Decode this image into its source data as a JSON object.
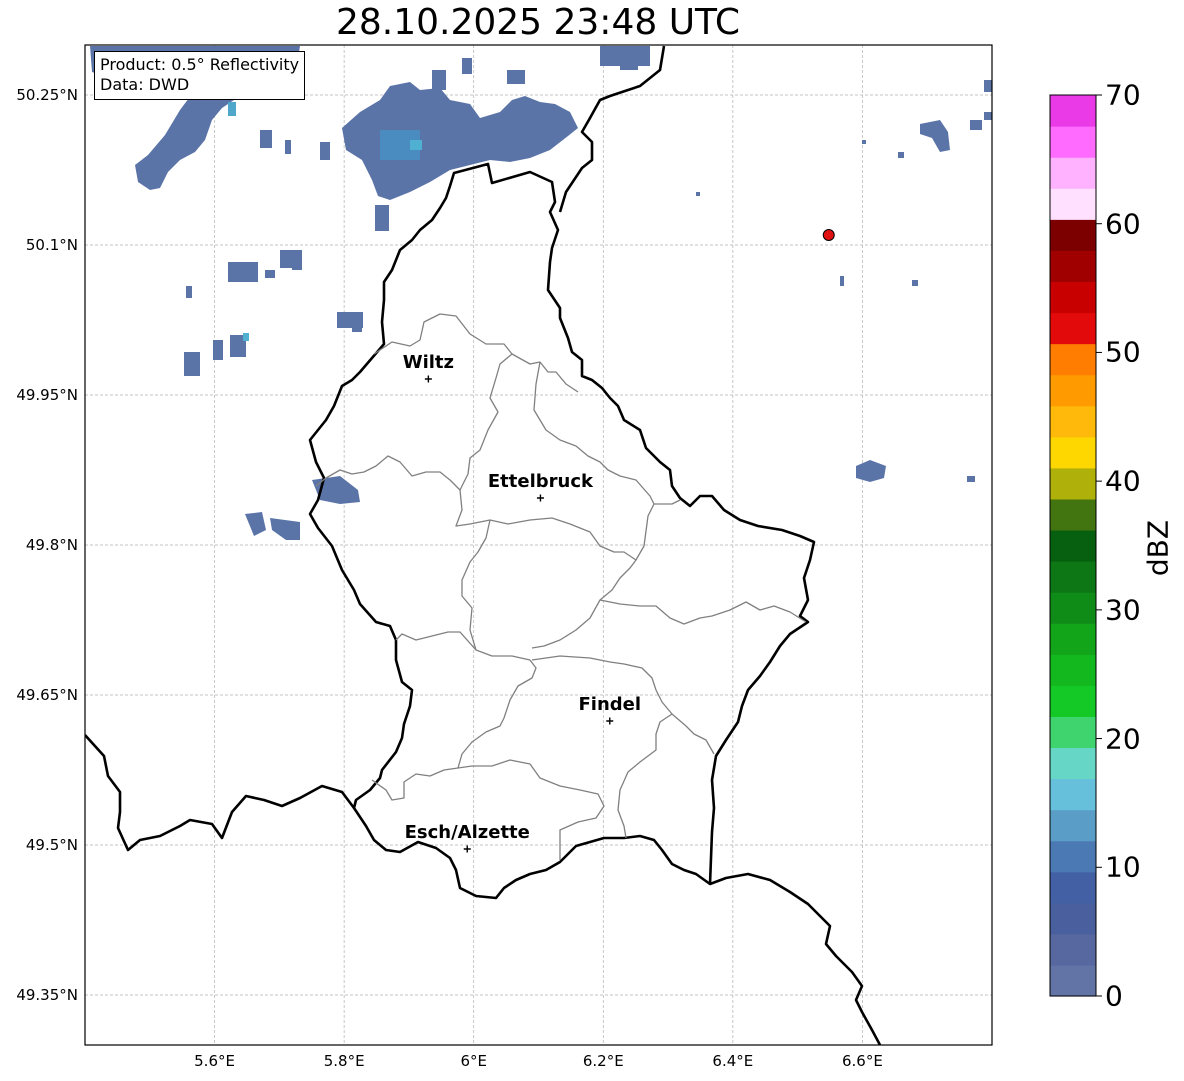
{
  "title": "28.10.2025 23:48 UTC",
  "info_box": {
    "product": "Product: 0.5° Reflectivity",
    "source": "Data: DWD"
  },
  "extent": {
    "lon_min": 5.4,
    "lon_max": 6.8,
    "lat_min": 49.3,
    "lat_max": 50.3
  },
  "lat_ticks": [
    {
      "value": 50.25,
      "label": "50.25°N"
    },
    {
      "value": 50.1,
      "label": "50.1°N"
    },
    {
      "value": 49.95,
      "label": "49.95°N"
    },
    {
      "value": 49.8,
      "label": "49.8°N"
    },
    {
      "value": 49.65,
      "label": "49.65°N"
    },
    {
      "value": 49.5,
      "label": "49.5°N"
    },
    {
      "value": 49.35,
      "label": "49.35°N"
    }
  ],
  "lon_ticks": [
    {
      "value": 5.6,
      "label": "5.6°E"
    },
    {
      "value": 5.8,
      "label": "5.8°E"
    },
    {
      "value": 6.0,
      "label": "6°E"
    },
    {
      "value": 6.2,
      "label": "6.2°E"
    },
    {
      "value": 6.4,
      "label": "6.4°E"
    },
    {
      "value": 6.6,
      "label": "6.6°E"
    }
  ],
  "cities": [
    {
      "name": "Wiltz",
      "lon": 5.93,
      "lat": 49.966
    },
    {
      "name": "Ettelbruck",
      "lon": 6.103,
      "lat": 49.847
    },
    {
      "name": "Findel",
      "lon": 6.21,
      "lat": 49.624
    },
    {
      "name": "Esch/Alzette",
      "lon": 5.99,
      "lat": 49.496
    }
  ],
  "radar_site": {
    "lon": 6.548,
    "lat": 50.11,
    "color": "#e01010"
  },
  "colorbar": {
    "label": "dBZ",
    "min": 0,
    "max": 70,
    "ticks": [
      "0",
      "10",
      "20",
      "30",
      "40",
      "50",
      "60",
      "70"
    ],
    "colors": [
      "#6273a6",
      "#57679f",
      "#4a609e",
      "#4360a4",
      "#4a79b3",
      "#5a9ec8",
      "#66c0dc",
      "#66d6c6",
      "#40d46e",
      "#14c925",
      "#12b81d",
      "#12a419",
      "#0f8c17",
      "#0c7714",
      "#075f10",
      "#427410",
      "#b0b00a",
      "#ffd700",
      "#ffb90a",
      "#ff9b00",
      "#ff7d00",
      "#e20a0a",
      "#c80000",
      "#a10000",
      "#7c0000",
      "#ffe1ff",
      "#ffb2ff",
      "#ff6bff",
      "#ea3ae8"
    ]
  }
}
